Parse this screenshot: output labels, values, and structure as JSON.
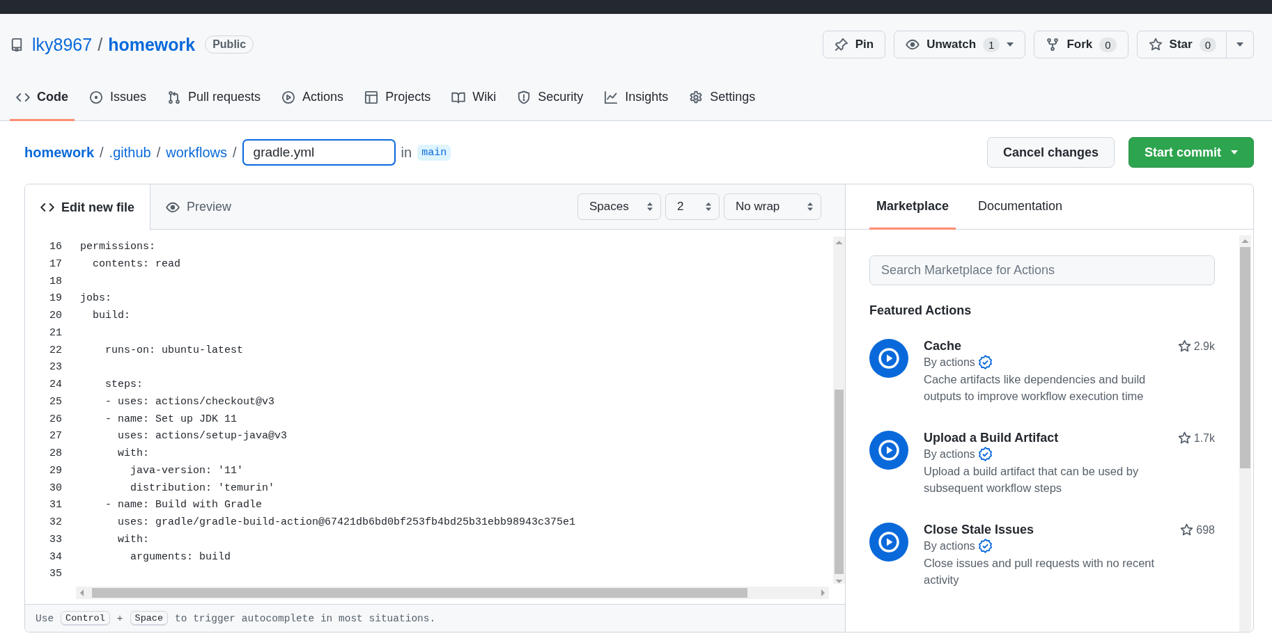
{
  "repo_header": {
    "owner": "lky8967",
    "separator": "/",
    "repo": "homework",
    "visibility": "Public",
    "buttons": [
      {
        "kind": "pin",
        "label": "Pin",
        "caret": false
      },
      {
        "kind": "watch",
        "label": "Unwatch",
        "count": "1",
        "caret": true
      },
      {
        "kind": "fork",
        "label": "Fork",
        "count": "0",
        "caret": false
      },
      {
        "kind": "star",
        "label": "Star",
        "count": "0",
        "caret": false,
        "split_caret": true
      }
    ]
  },
  "repo_tabs": [
    {
      "kind": "code",
      "label": "Code",
      "selected": true
    },
    {
      "kind": "issues",
      "label": "Issues",
      "selected": false
    },
    {
      "kind": "pulls",
      "label": "Pull requests",
      "selected": false
    },
    {
      "kind": "actions",
      "label": "Actions",
      "selected": false
    },
    {
      "kind": "projects",
      "label": "Projects",
      "selected": false
    },
    {
      "kind": "wiki",
      "label": "Wiki",
      "selected": false
    },
    {
      "kind": "security",
      "label": "Security",
      "selected": false
    },
    {
      "kind": "insights",
      "label": "Insights",
      "selected": false
    },
    {
      "kind": "settings",
      "label": "Settings",
      "selected": false
    }
  ],
  "breadcrumb": {
    "parts": [
      "homework",
      ".github",
      "workflows"
    ],
    "separator": "/",
    "filename": "gradle.yml",
    "in_label": "in",
    "branch": "main"
  },
  "commit_buttons": [
    {
      "kind": "secondary",
      "label": "Cancel changes",
      "caret": false
    },
    {
      "kind": "primary",
      "label": "Start commit",
      "caret": true
    }
  ],
  "editor": {
    "tabs": [
      {
        "kind": "edit",
        "label": "Edit new file",
        "selected": true
      },
      {
        "kind": "preview",
        "label": "Preview",
        "selected": false
      }
    ],
    "selects": [
      "Spaces",
      "2",
      "No wrap"
    ],
    "lines": [
      {
        "number": "16",
        "text": "permissions:"
      },
      {
        "number": "17",
        "text": "  contents: read"
      },
      {
        "number": "18"
      },
      {
        "number": "19",
        "text": "jobs:"
      },
      {
        "number": "20",
        "text": "  build:"
      },
      {
        "number": "21"
      },
      {
        "number": "22",
        "text": "    runs-on: ubuntu-latest"
      },
      {
        "number": "23"
      },
      {
        "number": "24",
        "text": "    steps:"
      },
      {
        "number": "25",
        "text": "    - uses: actions/checkout@v3"
      },
      {
        "number": "26",
        "text": "    - name: Set up JDK 11"
      },
      {
        "number": "27",
        "text": "      uses: actions/setup-java@v3"
      },
      {
        "number": "28",
        "text": "      with:"
      },
      {
        "number": "29",
        "text": "        java-version: '11'"
      },
      {
        "number": "30",
        "text": "        distribution: 'temurin'"
      },
      {
        "number": "31",
        "text": "    - name: Build with Gradle"
      },
      {
        "number": "32",
        "text": "      uses: gradle/gradle-build-action@67421db6bd0bf253fb4bd25b31ebb98943c375e1"
      },
      {
        "number": "33",
        "text": "      with:"
      },
      {
        "number": "34",
        "text": "        arguments: build"
      },
      {
        "number": "35"
      }
    ],
    "hint": [
      {
        "kind": "text",
        "text": "Use"
      },
      {
        "kind": "key",
        "text": "Control"
      },
      {
        "kind": "text",
        "text": "+"
      },
      {
        "kind": "key",
        "text": "Space"
      },
      {
        "kind": "text",
        "text": "to trigger autocomplete in most situations."
      }
    ]
  },
  "side_panel": {
    "tabs": [
      {
        "label": "Marketplace",
        "selected": true
      },
      {
        "label": "Documentation",
        "selected": false
      }
    ],
    "search": {
      "placeholder": "Search Marketplace for Actions"
    },
    "heading": "Featured Actions",
    "actions": [
      {
        "name": "Cache",
        "author": "By actions",
        "verified": true,
        "star_count": "2.9k",
        "description": "Cache artifacts like dependencies and build outputs to improve workflow execution time"
      },
      {
        "name": "Upload a Build Artifact",
        "author": "By actions",
        "verified": true,
        "star_count": "1.7k",
        "description": "Upload a build artifact that can be used by subsequent workflow steps"
      },
      {
        "name": "Close Stale Issues",
        "author": "By actions",
        "verified": true,
        "star_count": "698",
        "description": "Close issues and pull requests with no recent activity"
      }
    ]
  }
}
